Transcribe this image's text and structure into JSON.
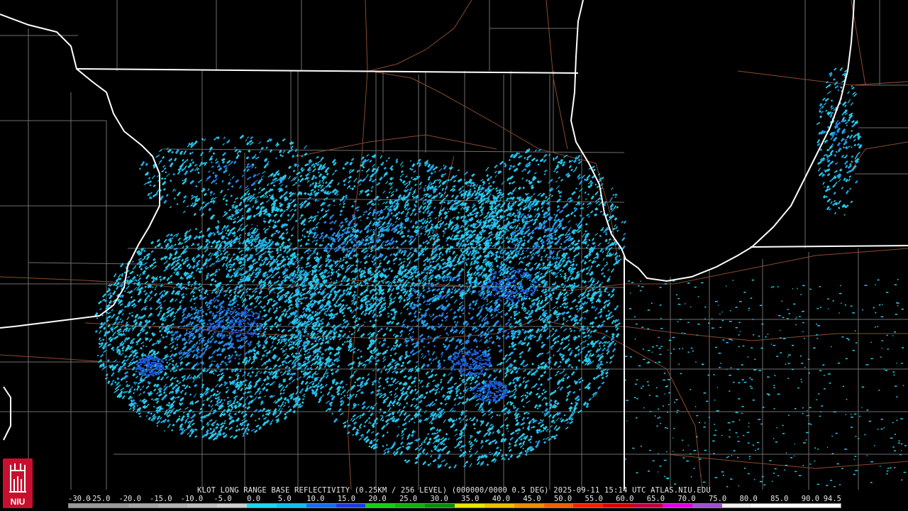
{
  "caption": "KLOT LONG RANGE BASE REFLECTIVITY (0.25KM / 256 LEVEL) (000000/0000 0.5 DEG) 2025-09-11 15:14 UTC  ATLAS.NIU.EDU",
  "legend": {
    "labels": [
      "-30.0",
      "-25.0",
      "-20.0",
      "-15.0",
      "-10.0",
      "-5.0",
      "0.0",
      "5.0",
      "10.0",
      "15.0",
      "20.0",
      "25.0",
      "30.0",
      "35.0",
      "40.0",
      "45.0",
      "50.0",
      "55.0",
      "60.0",
      "65.0",
      "70.0",
      "75.0",
      "80.0",
      "85.0",
      "90.0",
      "94.5"
    ],
    "colors": [
      "#9a9a9a",
      "#9a9a9a",
      "#a8a8a8",
      "#b4b4b4",
      "#c0c0c0",
      "#cfcfcf",
      "#1ad8f0",
      "#10c0ee",
      "#1a6cf0",
      "#1f3ae0",
      "#10d010",
      "#10b010",
      "#0a8c0a",
      "#e8e800",
      "#f0c000",
      "#f09000",
      "#f06000",
      "#f02000",
      "#d80000",
      "#c00040",
      "#e000e0",
      "#a050d0",
      "#f0f0f0",
      "#ffffff",
      "#ffffff",
      "#ffffff"
    ]
  },
  "logo": {
    "text": "NIU",
    "icon": "niu-tower-icon"
  },
  "map": {
    "state_border_color": "#ffffff",
    "county_line_color": "#6e6e6e",
    "highway_color": "#8b4a2e",
    "echo_colors": [
      "#29c9ea",
      "#1fa6e8",
      "#2a7ee6",
      "#1d5bd6"
    ],
    "radar_site": "KLOT"
  }
}
